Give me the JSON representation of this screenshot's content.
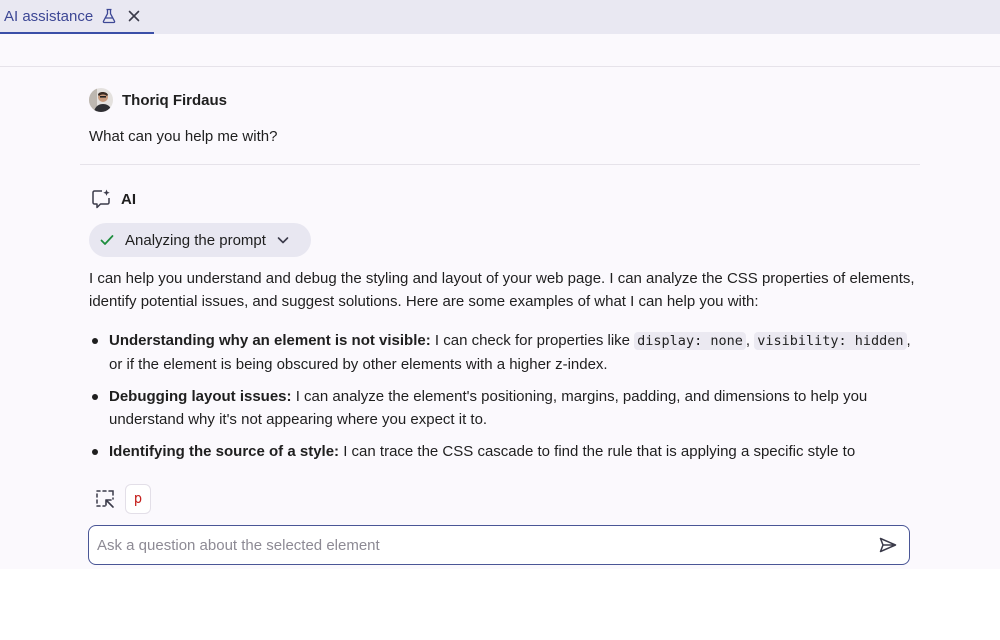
{
  "tab": {
    "title": "AI assistance"
  },
  "conversation": {
    "user": {
      "name": "Thoriq Firdaus",
      "message": "What can you help me with?"
    },
    "ai": {
      "name": "AI",
      "step": {
        "label": "Analyzing the prompt",
        "status": "done"
      },
      "intro": "I can help you understand and debug the styling and layout of your web page. I can analyze the CSS properties of elements, identify potential issues, and suggest solutions. Here are some examples of what I can help you with:",
      "bullets": [
        {
          "title": "Understanding why an element is not visible:",
          "pre": " I can check for properties like ",
          "code1": "display: none",
          "mid": ", ",
          "code2": "visibility: hidden",
          "post": ", or if the element is being obscured by other elements with a higher z-index."
        },
        {
          "title": "Debugging layout issues:",
          "text": " I can analyze the element's positioning, margins, padding, and dimensions to help you understand why it's not appearing where you expect it to."
        },
        {
          "title": "Identifying the source of a style:",
          "text": " I can trace the CSS cascade to find the rule that is applying a specific style to"
        }
      ]
    }
  },
  "context": {
    "selected_element": "p"
  },
  "input": {
    "placeholder": "Ask a question about the selected element",
    "value": ""
  },
  "colors": {
    "accent": "#3b4fa8",
    "check": "#1e8e3e",
    "element_chip": "#c5221f"
  }
}
